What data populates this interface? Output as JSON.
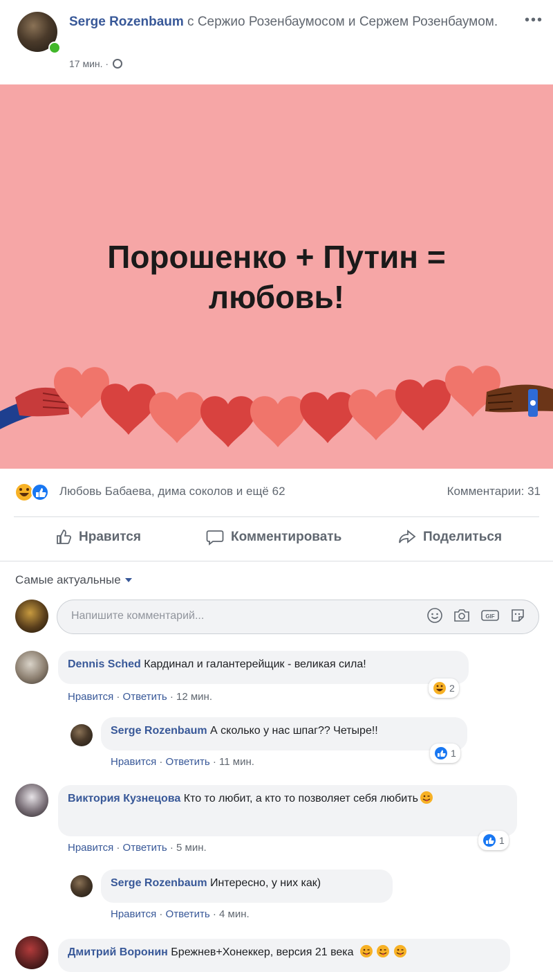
{
  "post": {
    "author": "Serge Rozenbaum",
    "with_text": " с Сержио Розенбаумосом и Сержем Розенбаумом.",
    "time": "17 мин. ·",
    "banner_line1": "Порошенко + Путин =",
    "banner_line2": "любовь!"
  },
  "stats": {
    "likers": "Любовь Бабаева, дима соколов и ещё 62",
    "comments": "Комментарии: 31"
  },
  "actions": {
    "like": "Нравится",
    "comment": "Комментировать",
    "share": "Поделиться"
  },
  "sort_label": "Самые актуальные",
  "composer": {
    "placeholder": "Напишите комментарий..."
  },
  "comments": [
    {
      "name": "Dennis Sched",
      "text": " Кардинал и галантерейщик - великая сила!",
      "like": "Нравится",
      "reply": "Ответить",
      "time": "12 мин.",
      "reaction_count": "2",
      "reply_item": {
        "name": "Serge Rozenbaum",
        "text": " А сколько у нас шпаг?? Четыре!!",
        "like": "Нравится",
        "reply": "Ответить",
        "time": "11 мин.",
        "reaction_count": "1"
      }
    },
    {
      "name": "Виктория Кузнецова",
      "text": " Кто то любит, а кто то позволяет себя любить",
      "like": "Нравится",
      "reply": "Ответить",
      "time": "5 мин.",
      "reaction_count": "1",
      "reply_item": {
        "name": "Serge Rozenbaum",
        "text": " Интересно, у них как)",
        "like": "Нравится",
        "reply": "Ответить",
        "time": "4 мин."
      }
    },
    {
      "name": "Дмитрий Воронин",
      "text": " Брежнев+Хонеккер, версия 21 века"
    }
  ],
  "colors": {
    "banner_bg": "#f6a6a6",
    "link_blue": "#385898",
    "like_blue": "#1877f2"
  }
}
